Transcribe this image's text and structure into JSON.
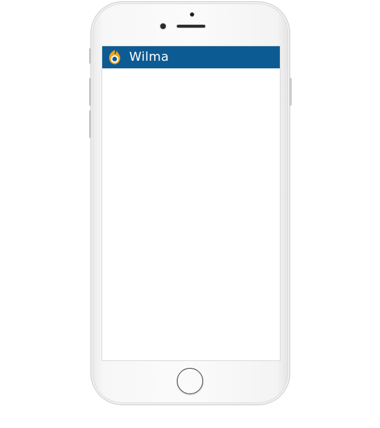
{
  "app": {
    "title": "Wilma",
    "header_color": "#0d5b93",
    "logo_icon": "wilma-logo-icon"
  },
  "device": {
    "type": "smartphone",
    "frame_color": "#f7f7f7"
  }
}
